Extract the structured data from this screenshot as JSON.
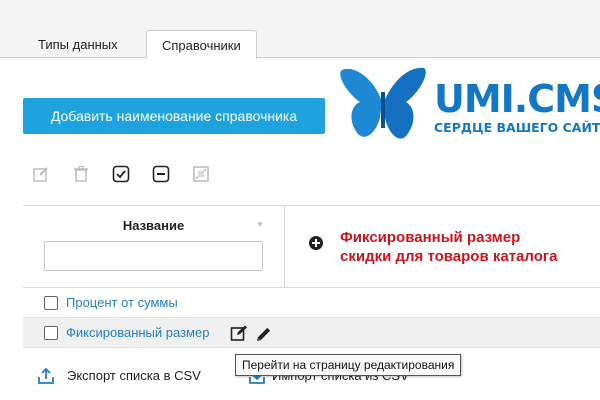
{
  "tabs": [
    {
      "label": "Типы данных",
      "active": false
    },
    {
      "label": "Справочники",
      "active": true
    }
  ],
  "add_button": {
    "label": "Добавить наименование справочника"
  },
  "logo": {
    "brand": "UMI.CMS",
    "tagline": "СЕРДЦЕ ВАШЕГО САЙТА™",
    "color": "#1377c6"
  },
  "toolbar": {
    "icons": [
      "edit-icon",
      "delete-icon",
      "check-icon",
      "minus-icon",
      "image-icon"
    ]
  },
  "table": {
    "column_header": "Название",
    "filter_value": "",
    "add_column_icon": "plus-circle-icon",
    "rows": [
      {
        "label": "Процент от суммы",
        "checked": false
      },
      {
        "label": "Фиксированный размер",
        "checked": false
      }
    ]
  },
  "annotation": {
    "line1": "Фиксированный размер",
    "line2": "скидки для товаров каталога",
    "color": "#c8161d"
  },
  "tooltip": {
    "text": "Перейти на страницу редактирования"
  },
  "footer": {
    "export_label": "Экспорт списка в CSV",
    "import_label": "Импорт списка из CSV"
  }
}
